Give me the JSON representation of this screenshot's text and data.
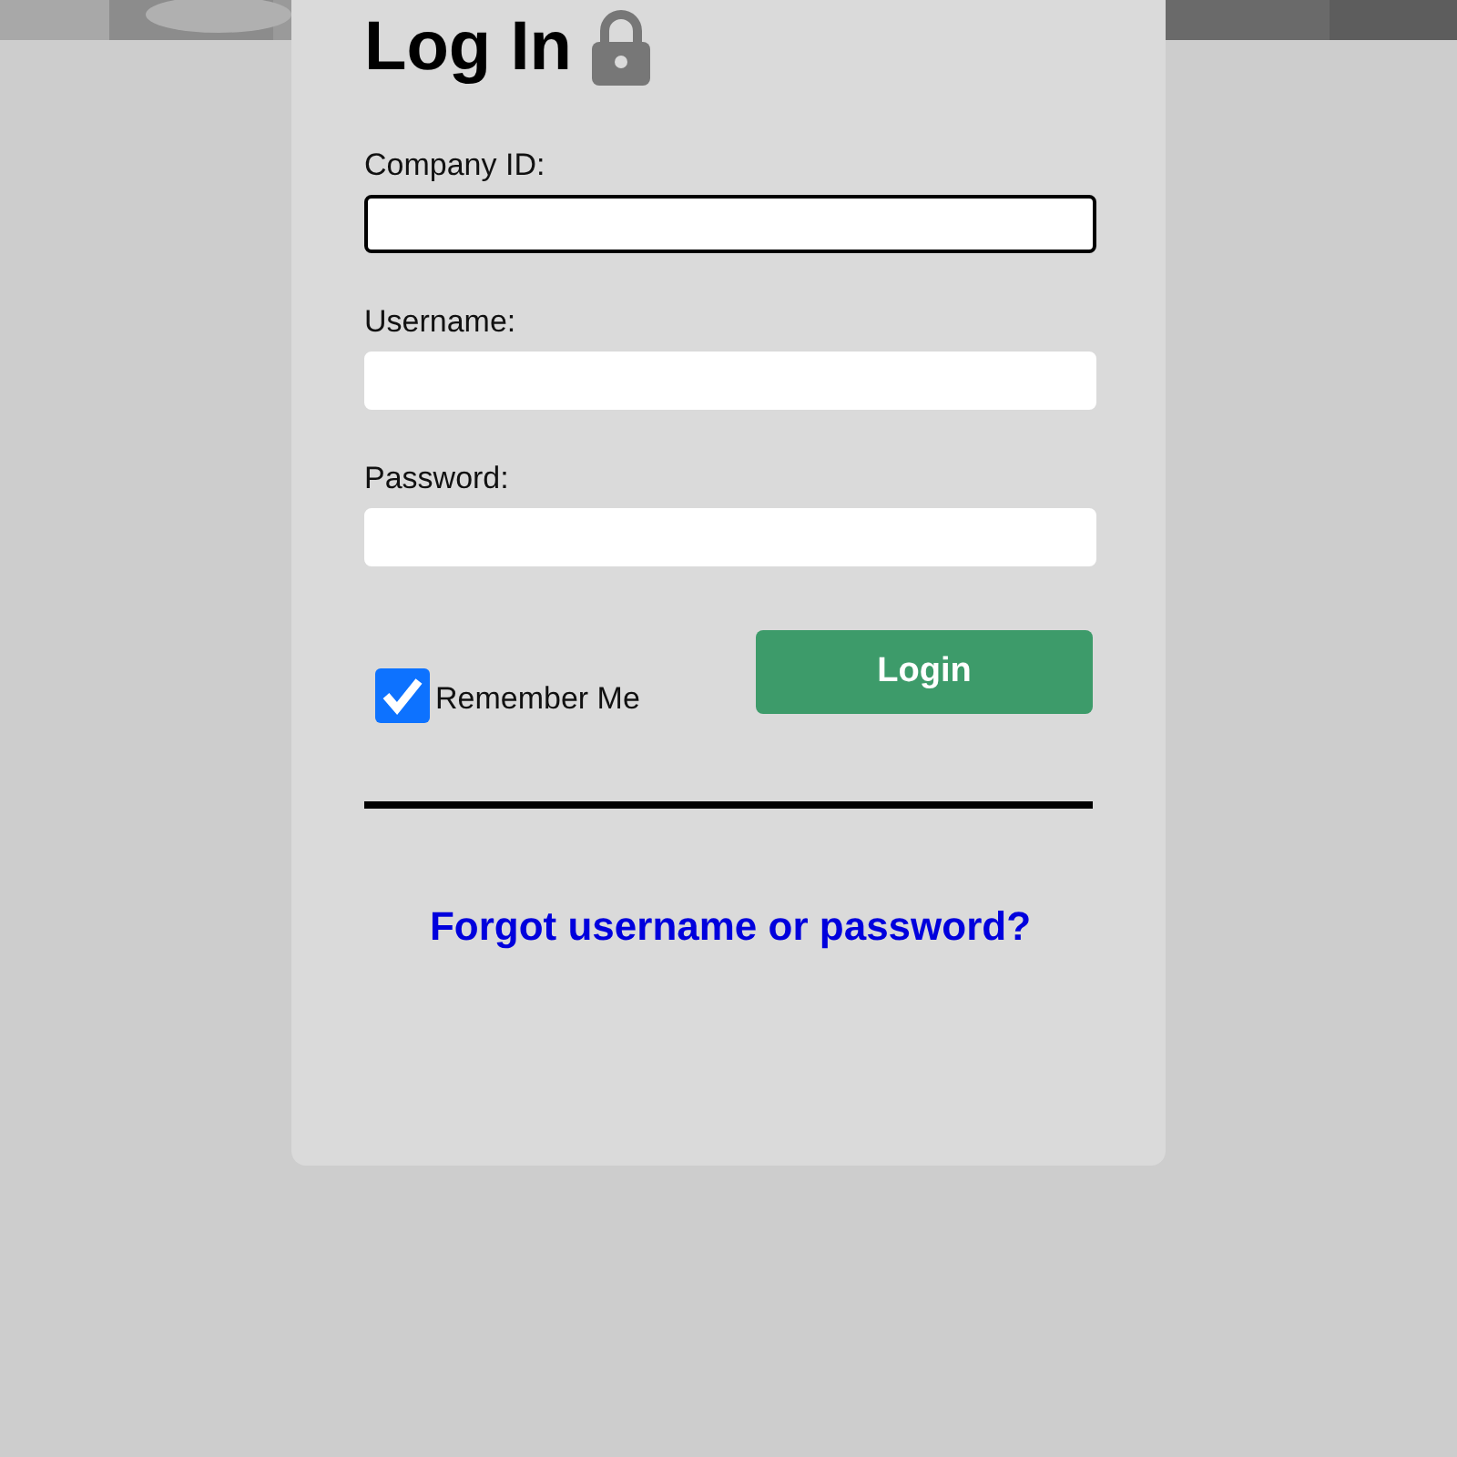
{
  "title": "Log In",
  "fields": [
    {
      "label": "Company ID:",
      "focused": true
    },
    {
      "label": "Username:",
      "focused": false
    },
    {
      "label": "Password:",
      "focused": false
    }
  ],
  "remember": {
    "label": "Remember Me",
    "checked": true
  },
  "button": "Login",
  "link": "Forgot username or password?"
}
